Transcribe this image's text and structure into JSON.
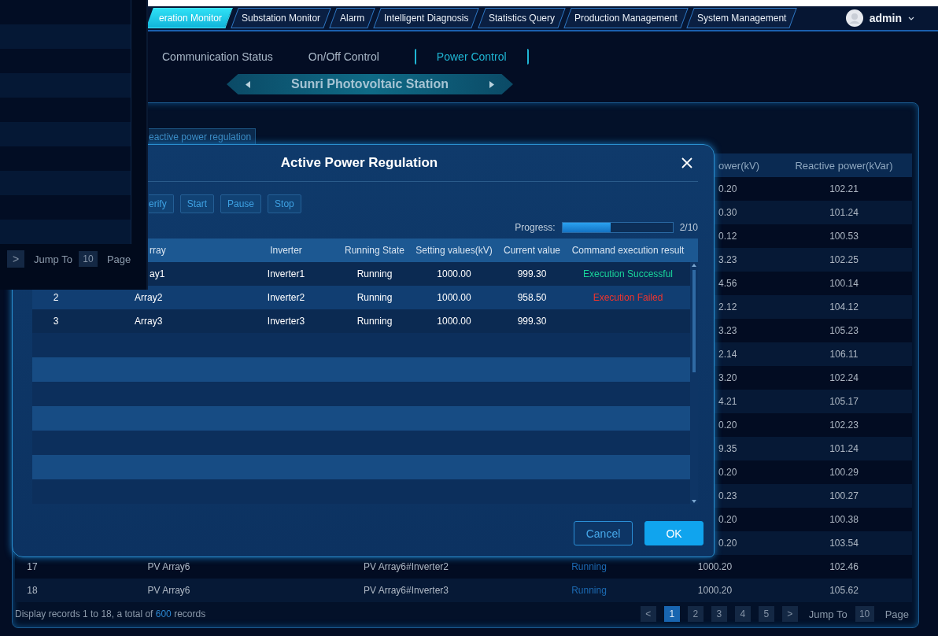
{
  "top_nav": {
    "tabs": [
      {
        "label": "eration Monitor",
        "selected": true
      },
      {
        "label": "Substation Monitor",
        "selected": false
      },
      {
        "label": "Alarm",
        "selected": false
      },
      {
        "label": "Intelligent Diagnosis",
        "selected": false
      },
      {
        "label": "Statistics Query",
        "selected": false
      },
      {
        "label": "Production Management",
        "selected": false
      },
      {
        "label": "System Management",
        "selected": false
      }
    ],
    "user": {
      "name": "admin"
    }
  },
  "sub_tabs": [
    {
      "label": "Communication Status",
      "selected": false
    },
    {
      "label": "On/Off Control",
      "selected": false
    },
    {
      "label": "Power Control",
      "selected": true
    }
  ],
  "station": {
    "name": "Sunri Photovoltaic Station"
  },
  "panel_tab": {
    "label": "eactive power regulation"
  },
  "table": {
    "columns": [
      {
        "label": "ower(kV)",
        "kind": "clipped"
      },
      {
        "label": "Reactive power(kVar)",
        "kind": "full"
      }
    ],
    "rows": [
      {
        "active_power": "0.20",
        "reactive_power": "102.21"
      },
      {
        "active_power": "0.30",
        "reactive_power": "101.24"
      },
      {
        "active_power": "0.12",
        "reactive_power": "100.53"
      },
      {
        "active_power": "3.23",
        "reactive_power": "102.25"
      },
      {
        "active_power": "4.56",
        "reactive_power": "100.14"
      },
      {
        "active_power": "2.12",
        "reactive_power": "104.12"
      },
      {
        "active_power": "3.23",
        "reactive_power": "105.23"
      },
      {
        "active_power": "2.14",
        "reactive_power": "106.11"
      },
      {
        "active_power": "3.20",
        "reactive_power": "102.24"
      },
      {
        "active_power": "4.21",
        "reactive_power": "105.17"
      },
      {
        "active_power": "0.20",
        "reactive_power": "102.23"
      },
      {
        "active_power": "9.35",
        "reactive_power": "101.24"
      },
      {
        "active_power": "0.20",
        "reactive_power": "100.29"
      },
      {
        "active_power": "0.23",
        "reactive_power": "100.27"
      },
      {
        "active_power": "0.20",
        "reactive_power": "100.38"
      },
      {
        "active_power": "0.20",
        "reactive_power": "103.54"
      },
      {
        "index": "17",
        "array": "PV Array6",
        "inverter": "PV Array6#Inverter2",
        "state": "Running",
        "active_power": "1000.20",
        "reactive_power": "102.46"
      },
      {
        "index": "18",
        "array": "PV Array6",
        "inverter": "PV Array6#Inverter3",
        "state": "Running",
        "active_power": "1000.20",
        "reactive_power": "105.62"
      }
    ]
  },
  "footer": {
    "before": "Display records 1 to 18, a total of ",
    "count": "600",
    "after": " records"
  },
  "pager": {
    "prev": "<",
    "pages": [
      {
        "label": "1",
        "selected": true
      },
      {
        "label": "2",
        "selected": false
      },
      {
        "label": "3",
        "selected": false
      },
      {
        "label": "4",
        "selected": false
      },
      {
        "label": "5",
        "selected": false
      }
    ],
    "next": ">",
    "jump_label": "Jump To",
    "page_value": "10",
    "page_suffix": "Page"
  },
  "side_panel": {
    "pager": {
      "next": ">",
      "jump_label": "Jump To",
      "page_value": "10",
      "page_suffix": "Page"
    }
  },
  "dialog": {
    "title": "Active Power Regulation",
    "toolbar": [
      {
        "label": "erify",
        "kind": "clipped"
      },
      {
        "label": "Start",
        "kind": "button"
      },
      {
        "label": "Pause",
        "kind": "button"
      },
      {
        "label": "Stop",
        "kind": "button"
      }
    ],
    "progress": {
      "label": "Progress:",
      "level": 0.44,
      "reading": "2/10"
    },
    "columns": [
      {
        "label": "rray",
        "kind": "clipped"
      },
      {
        "label": "Inverter",
        "kind": "center"
      },
      {
        "label": "Running State",
        "kind": "center"
      },
      {
        "label": "Setting values(kV)",
        "kind": "center"
      },
      {
        "label": "Current value",
        "kind": "center"
      },
      {
        "label": "Command execution result",
        "kind": "center"
      }
    ],
    "rows": [
      {
        "array": "ay1",
        "inverter": "Inverter1",
        "state": "Running",
        "setting": "1000.00",
        "current": "999.30",
        "result": "Execution Successful",
        "color": "#19d39a"
      },
      {
        "index": "2",
        "array": "Array2",
        "inverter": "Inverter2",
        "state": "Running",
        "setting": "1000.00",
        "current": "958.50",
        "result": "Execution Failed",
        "color": "#f0342c"
      },
      {
        "index": "3",
        "array": "Array3",
        "inverter": "Inverter3",
        "state": "Running",
        "setting": "1000.00",
        "current": "999.30"
      }
    ],
    "buttons": [
      {
        "label": "Cancel",
        "kind": "secondary"
      },
      {
        "label": "OK",
        "kind": "primary"
      }
    ]
  }
}
